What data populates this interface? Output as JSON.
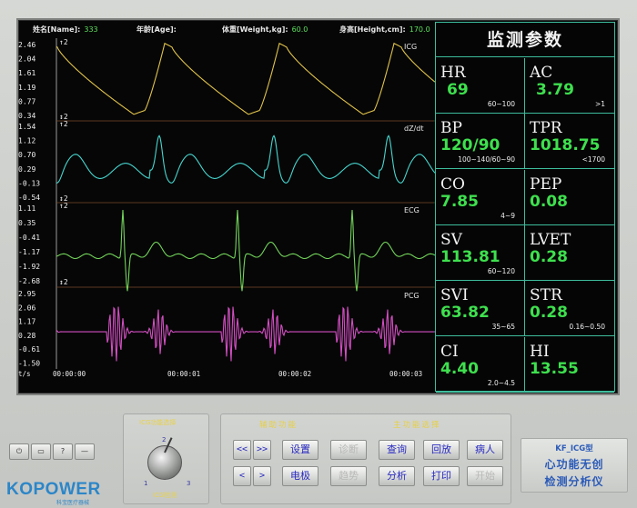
{
  "patient": {
    "name_label": "姓名[Name]:",
    "name_value": "333",
    "age_label": "年龄[Age]:",
    "age_value": "",
    "weight_label": "体重[Weight,kg]:",
    "weight_value": "60.0",
    "height_label": "身高[Height,cm]:",
    "height_value": "170.0"
  },
  "channels": [
    {
      "label": "ICG",
      "color": "#e0c34a",
      "ticks": [
        "2.46",
        "2.04",
        "1.61",
        "1.19",
        "0.77",
        "0.34"
      ],
      "markers": [
        "2",
        "2"
      ]
    },
    {
      "label": "dZ/dt",
      "color": "#46d6cf",
      "ticks": [
        "1.54",
        "1.12",
        "0.70",
        "0.29",
        "-0.13",
        "-0.54"
      ],
      "markers": [
        "2",
        "2"
      ]
    },
    {
      "label": "ECG",
      "color": "#72d35a",
      "ticks": [
        "1.11",
        "0.35",
        "-0.41",
        "-1.17",
        "-1.92",
        "-2.68"
      ],
      "markers": [
        "2",
        "2"
      ]
    },
    {
      "label": "PCG",
      "color": "#d44fc4",
      "ticks": [
        "2.95",
        "2.06",
        "1.17",
        "0.28",
        "-0.61",
        "-1.50"
      ],
      "markers": []
    }
  ],
  "time_axis": {
    "unit_label": "t/s",
    "ticks": [
      "00:00:00",
      "00:00:01",
      "00:00:02",
      "00:00:03"
    ]
  },
  "params": {
    "title": "监测参数",
    "cells": [
      {
        "name": "HR",
        "value": "69",
        "range": "60~100"
      },
      {
        "name": "AC",
        "value": "3.79",
        "range": ">1"
      },
      {
        "name": "BP",
        "value": "120/90",
        "range": "100~140/60~90"
      },
      {
        "name": "TPR",
        "value": "1018.75",
        "range": "<1700"
      },
      {
        "name": "CO",
        "value": "7.85",
        "range": "4~9"
      },
      {
        "name": "PEP",
        "value": "0.08",
        "range": ""
      },
      {
        "name": "SV",
        "value": "113.81",
        "range": "60~120"
      },
      {
        "name": "LVET",
        "value": "0.28",
        "range": ""
      },
      {
        "name": "SVI",
        "value": "63.82",
        "range": "35~65"
      },
      {
        "name": "STR",
        "value": "0.28",
        "range": "0.16~0.50"
      },
      {
        "name": "CI",
        "value": "4.40",
        "range": "2.0~4.5"
      },
      {
        "name": "HI",
        "value": "13.55",
        "range": ""
      }
    ]
  },
  "left_buttons": {
    "power": "⏻",
    "b2": "▭",
    "help": "?",
    "minus": "—"
  },
  "logo": {
    "text": "KOPOWER",
    "sub": "科宝医疗器械"
  },
  "icg_select": {
    "title": "ICG功能选择",
    "detect": "ICG检测",
    "n1": "1",
    "n2": "2",
    "n3": "3"
  },
  "aux": {
    "title": "辅助功能",
    "prev": "<<",
    "next": ">>",
    "left": "<",
    "right": ">",
    "settings": "设置",
    "diagnose": "诊断",
    "electrode": "电极",
    "trend": "趋势"
  },
  "main_func": {
    "title": "主功能选择",
    "query": "查询",
    "replay": "回放",
    "patient": "病人",
    "analyze": "分析",
    "print": "打印",
    "start": "开始"
  },
  "brand": {
    "model": "KF_ICG型",
    "line1": "心功能无创",
    "line2": "检测分析仪"
  }
}
